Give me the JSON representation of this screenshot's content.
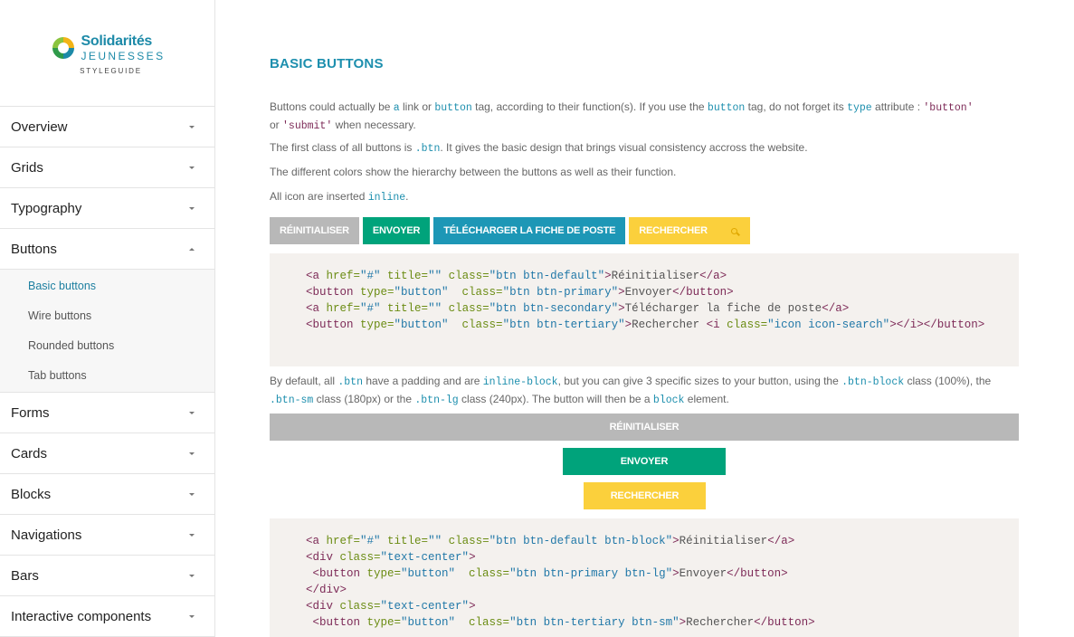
{
  "logo": {
    "line1": "Solidarités",
    "line2": "JEUNESSES",
    "line3": "STYLEGUIDE"
  },
  "sidebar": {
    "items": [
      {
        "label": "Overview"
      },
      {
        "label": "Grids"
      },
      {
        "label": "Typography"
      },
      {
        "label": "Buttons",
        "expanded": true
      },
      {
        "label": "Forms"
      },
      {
        "label": "Cards"
      },
      {
        "label": "Blocks"
      },
      {
        "label": "Navigations"
      },
      {
        "label": "Bars"
      },
      {
        "label": "Interactive components"
      }
    ],
    "sub_items": [
      {
        "label": "Basic buttons",
        "active": true
      },
      {
        "label": "Wire buttons"
      },
      {
        "label": "Rounded buttons"
      },
      {
        "label": "Tab buttons"
      }
    ]
  },
  "main": {
    "title": "BASIC BUTTONS",
    "p1": {
      "a": "Buttons could actually be ",
      "c1": "a",
      "b": " link or ",
      "c2": "button",
      "d": " tag, according to their function(s). If you use the ",
      "c3": "button",
      "e": " tag, do not forget its ",
      "c4": "type",
      "f": " attribute : ",
      "s1": "'button'",
      "g": "or ",
      "s2": "'submit'",
      "h": " when necessary."
    },
    "p2": {
      "a": "The first class of all buttons is ",
      "c1": ".btn",
      "b": ". It gives the basic design that brings visual consistency accross the website."
    },
    "p3": "The different colors show the hierarchy between the buttons as well as their function.",
    "p4": {
      "a": "All icon are inserted ",
      "c1": "inline",
      "b": "."
    },
    "buttons": {
      "reset": "RÉINITIALISER",
      "send": "ENVOYER",
      "download": "TÉLÉCHARGER LA FICHE DE POSTE",
      "search": "RECHERCHER"
    },
    "p5": {
      "a": "By default, all ",
      "c1": ".btn",
      "b": " have a padding and are ",
      "c2": "inline-block",
      "c": ", but you can give 3 specific sizes to your button, using the ",
      "c3": ".btn-block",
      "d": " class (100%), the",
      "c4": ".btn-sm",
      "e": " class (180px) or the ",
      "c5": ".btn-lg",
      "f": " class (240px). The button will then be a ",
      "c6": "block",
      "g": " element."
    },
    "sized_buttons": {
      "block": "RÉINITIALISER",
      "lg": "ENVOYER",
      "sm": "RECHERCHER"
    }
  },
  "code1": {
    "line1": {
      "t1": "<a",
      "a1": " href=",
      "v1": "\"#\"",
      "a2": " title=",
      "v2": "\"\"",
      "a3": " class=",
      "v3": "\"btn btn-default\"",
      "t2": ">",
      "x": "Réinitialiser",
      "t3": "</a>"
    },
    "line2": {
      "t1": "<button",
      "a1": " type=",
      "v1": "\"button\"",
      "a2": "  class=",
      "v2": "\"btn btn-primary\"",
      "t2": ">",
      "x": "Envoyer",
      "t3": "</button>"
    },
    "line3": {
      "t1": "<a",
      "a1": " href=",
      "v1": "\"#\"",
      "a2": " title=",
      "v2": "\"\"",
      "a3": " class=",
      "v3": "\"btn btn-secondary\"",
      "t2": ">",
      "x": "Télécharger la fiche de poste",
      "t3": "</a>"
    },
    "line4": {
      "t1": "<button",
      "a1": " type=",
      "v1": "\"button\"",
      "a2": "  class=",
      "v2": "\"btn btn-tertiary\"",
      "t2": ">",
      "x": "Rechercher ",
      "t3": "<i",
      "a3": " class=",
      "v3": "\"icon icon-search\"",
      "t4": "></i></button>"
    }
  },
  "code2": {
    "line1": {
      "t1": "<a",
      "a1": " href=",
      "v1": "\"#\"",
      "a2": " title=",
      "v2": "\"\"",
      "a3": " class=",
      "v3": "\"btn btn-default btn-block\"",
      "t2": ">",
      "x": "Réinitialiser",
      "t3": "</a>"
    },
    "line2": {
      "t1": "<div",
      "a1": " class=",
      "v1": "\"text-center\"",
      "t2": ">"
    },
    "line3": {
      "t1": " <button",
      "a1": " type=",
      "v1": "\"button\"",
      "a2": "  class=",
      "v2": "\"btn btn-primary btn-lg\"",
      "t2": ">",
      "x": "Envoyer",
      "t3": "</button>"
    },
    "line4": {
      "t1": "</div>"
    },
    "line5": {
      "t1": "<div",
      "a1": " class=",
      "v1": "\"text-center\"",
      "t2": ">"
    },
    "line6": {
      "t1": " <button",
      "a1": " type=",
      "v1": "\"button\"",
      "a2": "  class=",
      "v2": "\"btn btn-tertiary btn-sm\"",
      "t2": ">",
      "x": "Rechercher",
      "t3": "</button>"
    }
  },
  "colors": {
    "primary": "#00a37b",
    "secondary": "#1d97b6",
    "tertiary": "#fbd03c",
    "default": "#b8b8b8",
    "title": "#1d8fae"
  }
}
